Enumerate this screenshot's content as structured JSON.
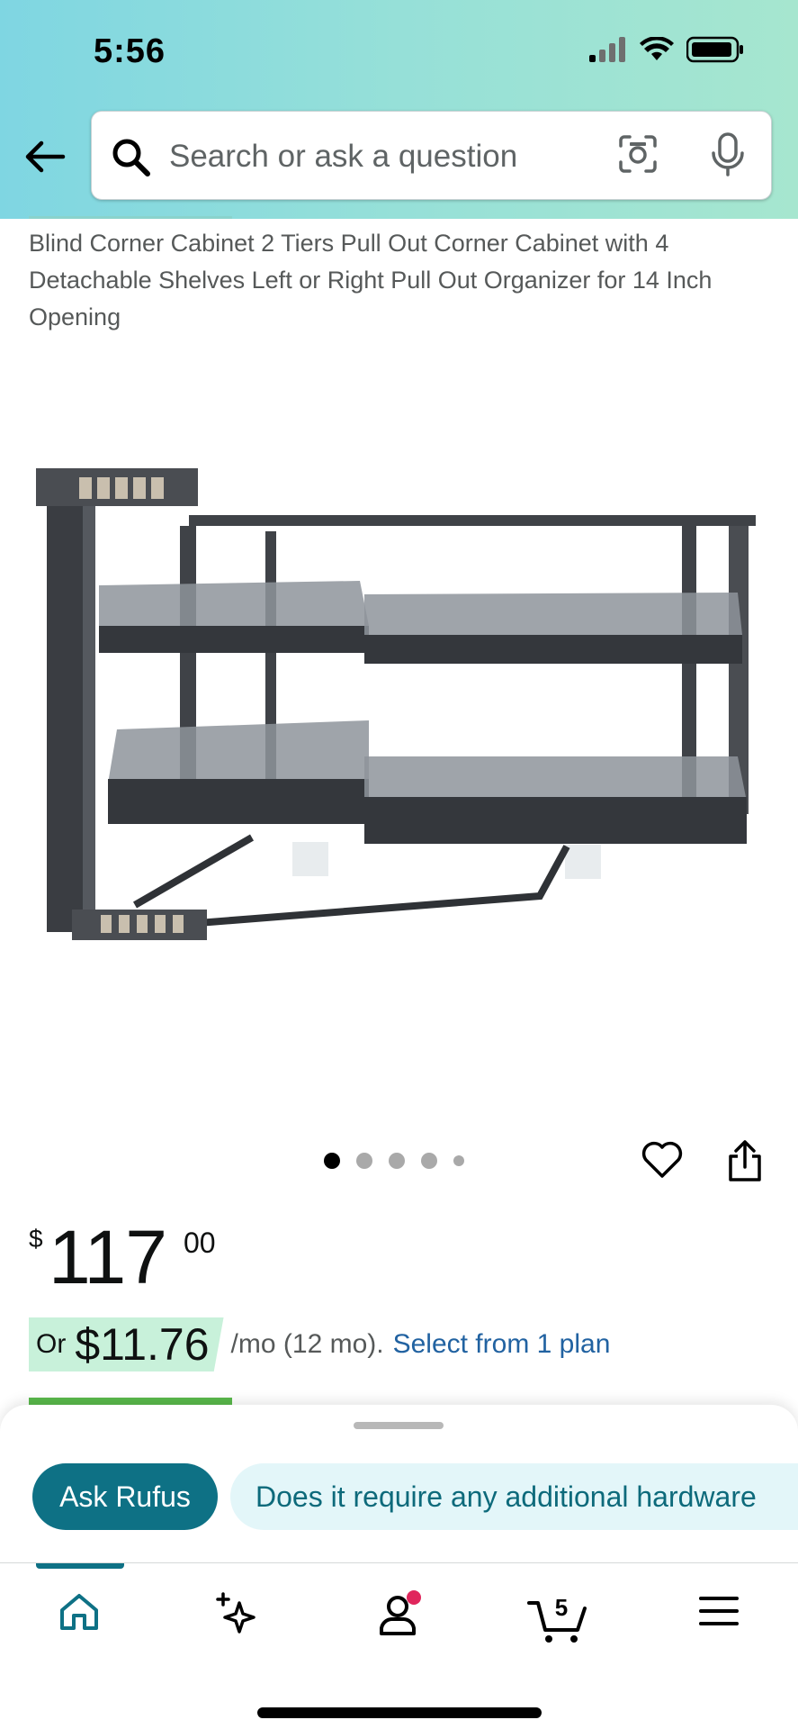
{
  "status_bar": {
    "time": "5:56"
  },
  "search": {
    "placeholder": "Search or ask a question"
  },
  "product": {
    "title": "Blind Corner Cabinet 2 Tiers Pull Out Corner Cabinet with 4 Detachable Shelves Left or Right Pull Out Organizer for 14 Inch Opening",
    "image_pages": 5,
    "active_image": 1
  },
  "price": {
    "symbol": "$",
    "whole": "117",
    "fraction": "00"
  },
  "financing": {
    "or": "Or",
    "amount": "$11.76",
    "term": "/mo (12 mo).",
    "link": "Select from 1 plan"
  },
  "rufus": {
    "button": "Ask Rufus",
    "question": "Does it require any additional hardware"
  },
  "nav": {
    "cart_count": "5"
  },
  "colors": {
    "accent": "#0e7185",
    "link": "#2162a1",
    "finance_bg": "#c8f1da",
    "notify": "#e0265c"
  }
}
